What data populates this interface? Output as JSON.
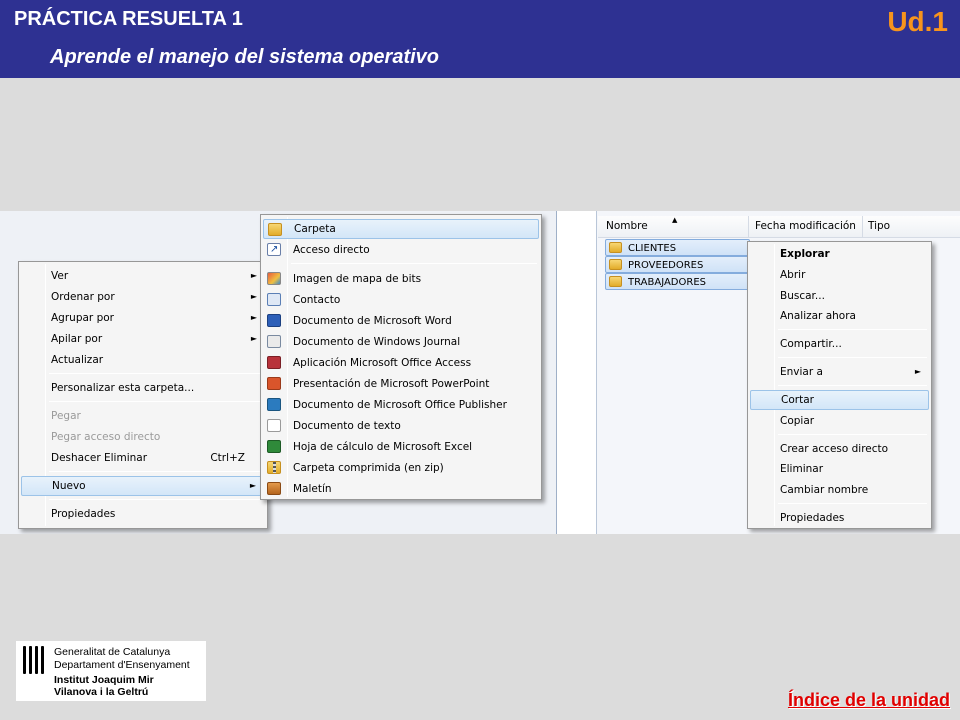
{
  "header": {
    "title": "PRÁCTICA RESUELTA 1",
    "subtitle": "Aprende el manejo del sistema operativo",
    "unit": "Ud.1",
    "bg_color": "#2e3192",
    "unit_color": "#f7941d"
  },
  "context_menu": {
    "items": [
      {
        "label": "Ver",
        "arrow": "►"
      },
      {
        "label": "Ordenar por",
        "arrow": "►"
      },
      {
        "label": "Agrupar por",
        "arrow": "►"
      },
      {
        "label": "Apilar por",
        "arrow": "►"
      },
      {
        "label": "Actualizar"
      },
      {
        "label": "Personalizar esta carpeta..."
      },
      {
        "label": "Pegar",
        "disabled": true
      },
      {
        "label": "Pegar acceso directo",
        "disabled": true
      },
      {
        "label": "Deshacer Eliminar",
        "shortcut": "Ctrl+Z"
      },
      {
        "label": "Nuevo",
        "arrow": "►",
        "selected": true
      },
      {
        "label": "Propiedades"
      }
    ]
  },
  "new_submenu": {
    "items": [
      {
        "label": "Carpeta",
        "icon": "folder-icon",
        "selected": true
      },
      {
        "label": "Acceso directo",
        "icon": "shortcut-icon"
      },
      {
        "label": "Imagen de mapa de bits",
        "icon": "bitmap-icon"
      },
      {
        "label": "Contacto",
        "icon": "contact-icon"
      },
      {
        "label": "Documento de Microsoft Word",
        "icon": "word-icon"
      },
      {
        "label": "Documento de Windows Journal",
        "icon": "journal-icon"
      },
      {
        "label": "Aplicación Microsoft Office Access",
        "icon": "access-icon"
      },
      {
        "label": "Presentación de Microsoft PowerPoint",
        "icon": "powerpoint-icon"
      },
      {
        "label": "Documento de Microsoft Office Publisher",
        "icon": "publisher-icon"
      },
      {
        "label": "Documento de texto",
        "icon": "text-document-icon"
      },
      {
        "label": "Hoja de cálculo de Microsoft Excel",
        "icon": "excel-icon"
      },
      {
        "label": "Carpeta comprimida (en zip)",
        "icon": "zip-folder-icon"
      },
      {
        "label": "Maletín",
        "icon": "briefcase-icon"
      }
    ]
  },
  "explorer": {
    "columns": [
      "Nombre",
      "Fecha modificación",
      "Tipo"
    ],
    "folders": [
      "CLIENTES",
      "PROVEEDORES",
      "TRABAJADORES"
    ]
  },
  "folder_menu": {
    "items": [
      {
        "label": "Explorar",
        "bold": true
      },
      {
        "label": "Abrir"
      },
      {
        "label": "Buscar..."
      },
      {
        "label": "Analizar ahora"
      },
      {
        "label": "Compartir..."
      },
      {
        "label": "Enviar a",
        "arrow": "►"
      },
      {
        "label": "Cortar",
        "selected": true
      },
      {
        "label": "Copiar"
      },
      {
        "label": "Crear acceso directo"
      },
      {
        "label": "Eliminar"
      },
      {
        "label": "Cambiar nombre"
      },
      {
        "label": "Propiedades"
      }
    ]
  },
  "logo": {
    "line1": "Generalitat de Catalunya",
    "line2": "Departament d'Ensenyament",
    "line3": "Institut Joaquim Mir",
    "line4": "Vilanova i la Geltrú"
  },
  "footer": {
    "index_link": "Índice de la unidad",
    "link_color": "#e00000"
  }
}
